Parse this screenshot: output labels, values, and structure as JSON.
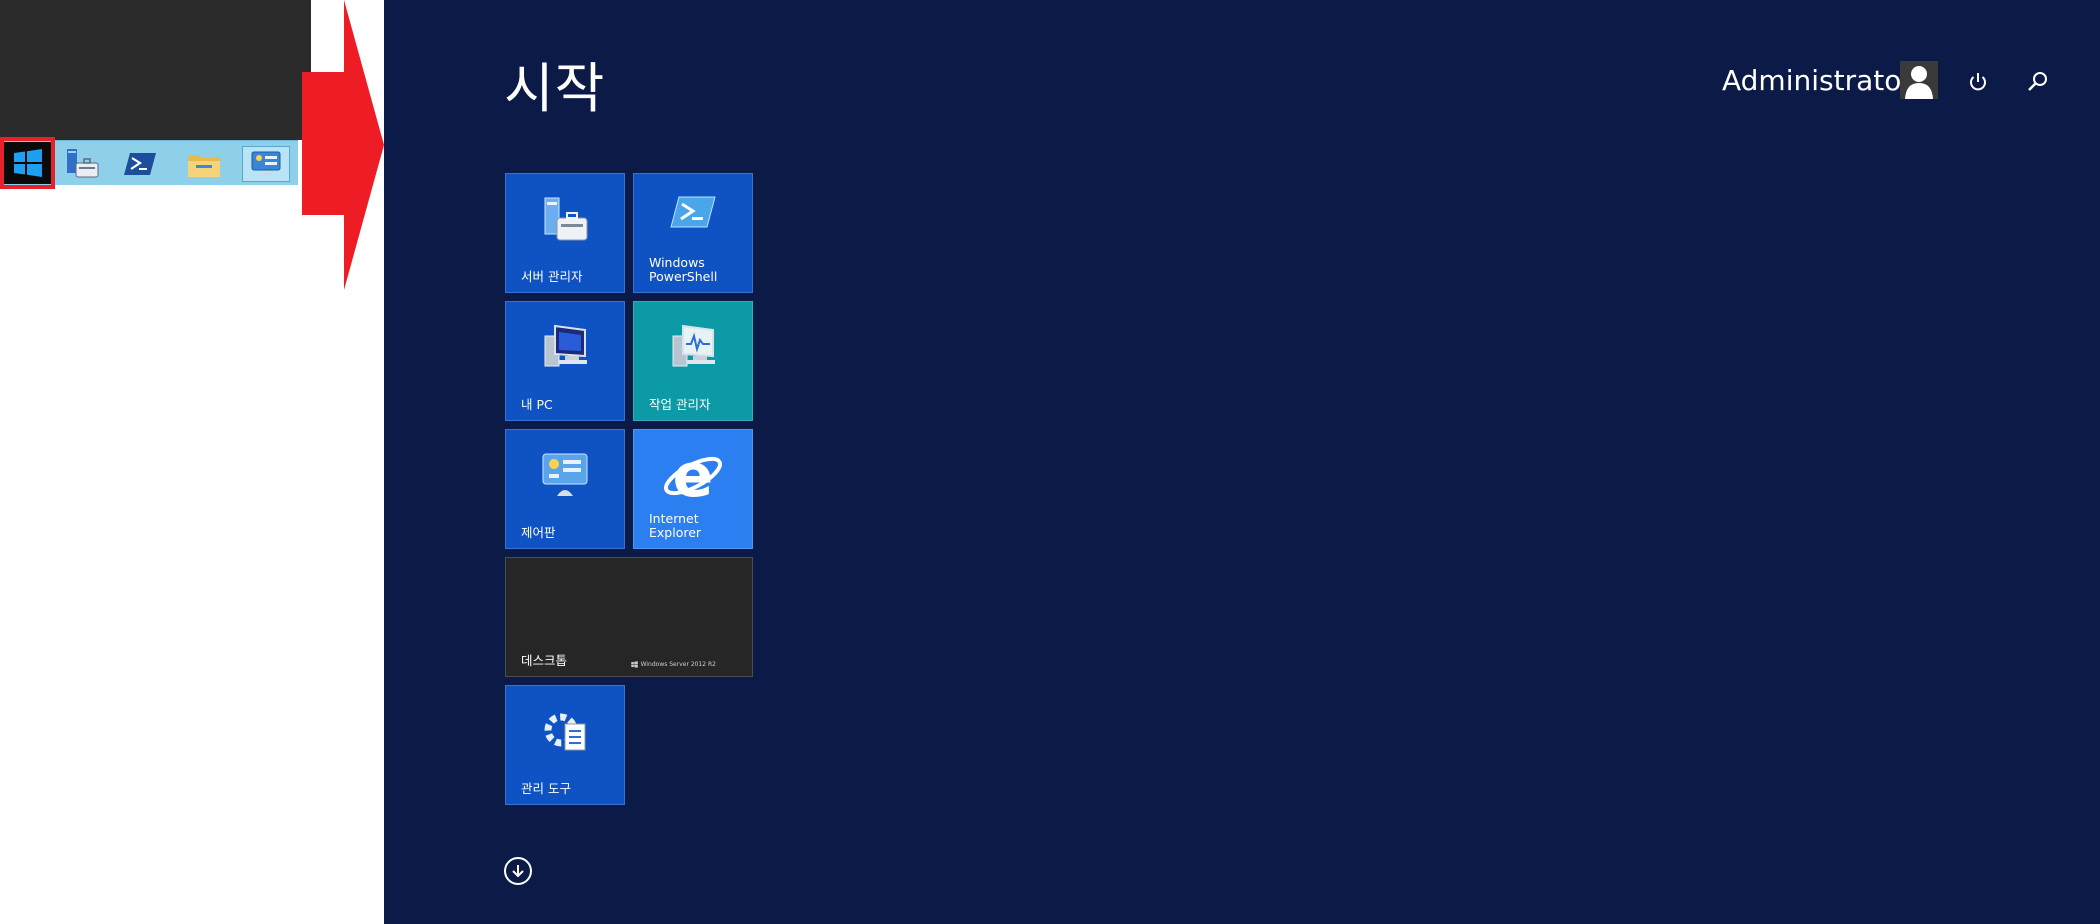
{
  "taskbar": {
    "start_icon": "windows-logo-icon",
    "pinned": [
      {
        "name": "server-manager-icon",
        "active": false
      },
      {
        "name": "powershell-icon",
        "active": false
      },
      {
        "name": "file-explorer-icon",
        "active": false
      },
      {
        "name": "control-panel-icon",
        "active": true
      }
    ]
  },
  "start_screen": {
    "title": "시작",
    "user_name": "Administrator",
    "icons": {
      "avatar": "user-avatar-icon",
      "power": "power-icon",
      "search": "search-icon",
      "all_apps": "down-arrow-icon"
    },
    "tiles": [
      {
        "label": "서버 관리자",
        "icon": "server-manager-icon",
        "color": "#0e52c4"
      },
      {
        "label": "Windows\nPowerShell",
        "icon": "powershell-icon",
        "color": "#0e52c4"
      },
      {
        "label": "내 PC",
        "icon": "computer-icon",
        "color": "#0e52c4"
      },
      {
        "label": "작업 관리자",
        "icon": "task-manager-icon",
        "color": "#0b9aa6"
      },
      {
        "label": "제어판",
        "icon": "control-panel-icon",
        "color": "#0e52c4"
      },
      {
        "label": "Internet Explorer",
        "icon": "internet-explorer-icon",
        "color": "#2b7ff0"
      },
      {
        "label": "데스크톱",
        "icon": "desktop-icon",
        "color": "#262626",
        "brand": "Windows Server 2012 R2"
      },
      {
        "label": "관리 도구",
        "icon": "admin-tools-icon",
        "color": "#0e52c4"
      }
    ]
  },
  "colors": {
    "highlight": "#e8202a",
    "start_bg": "#0b1a46",
    "taskbar": "#8ed0ea"
  }
}
